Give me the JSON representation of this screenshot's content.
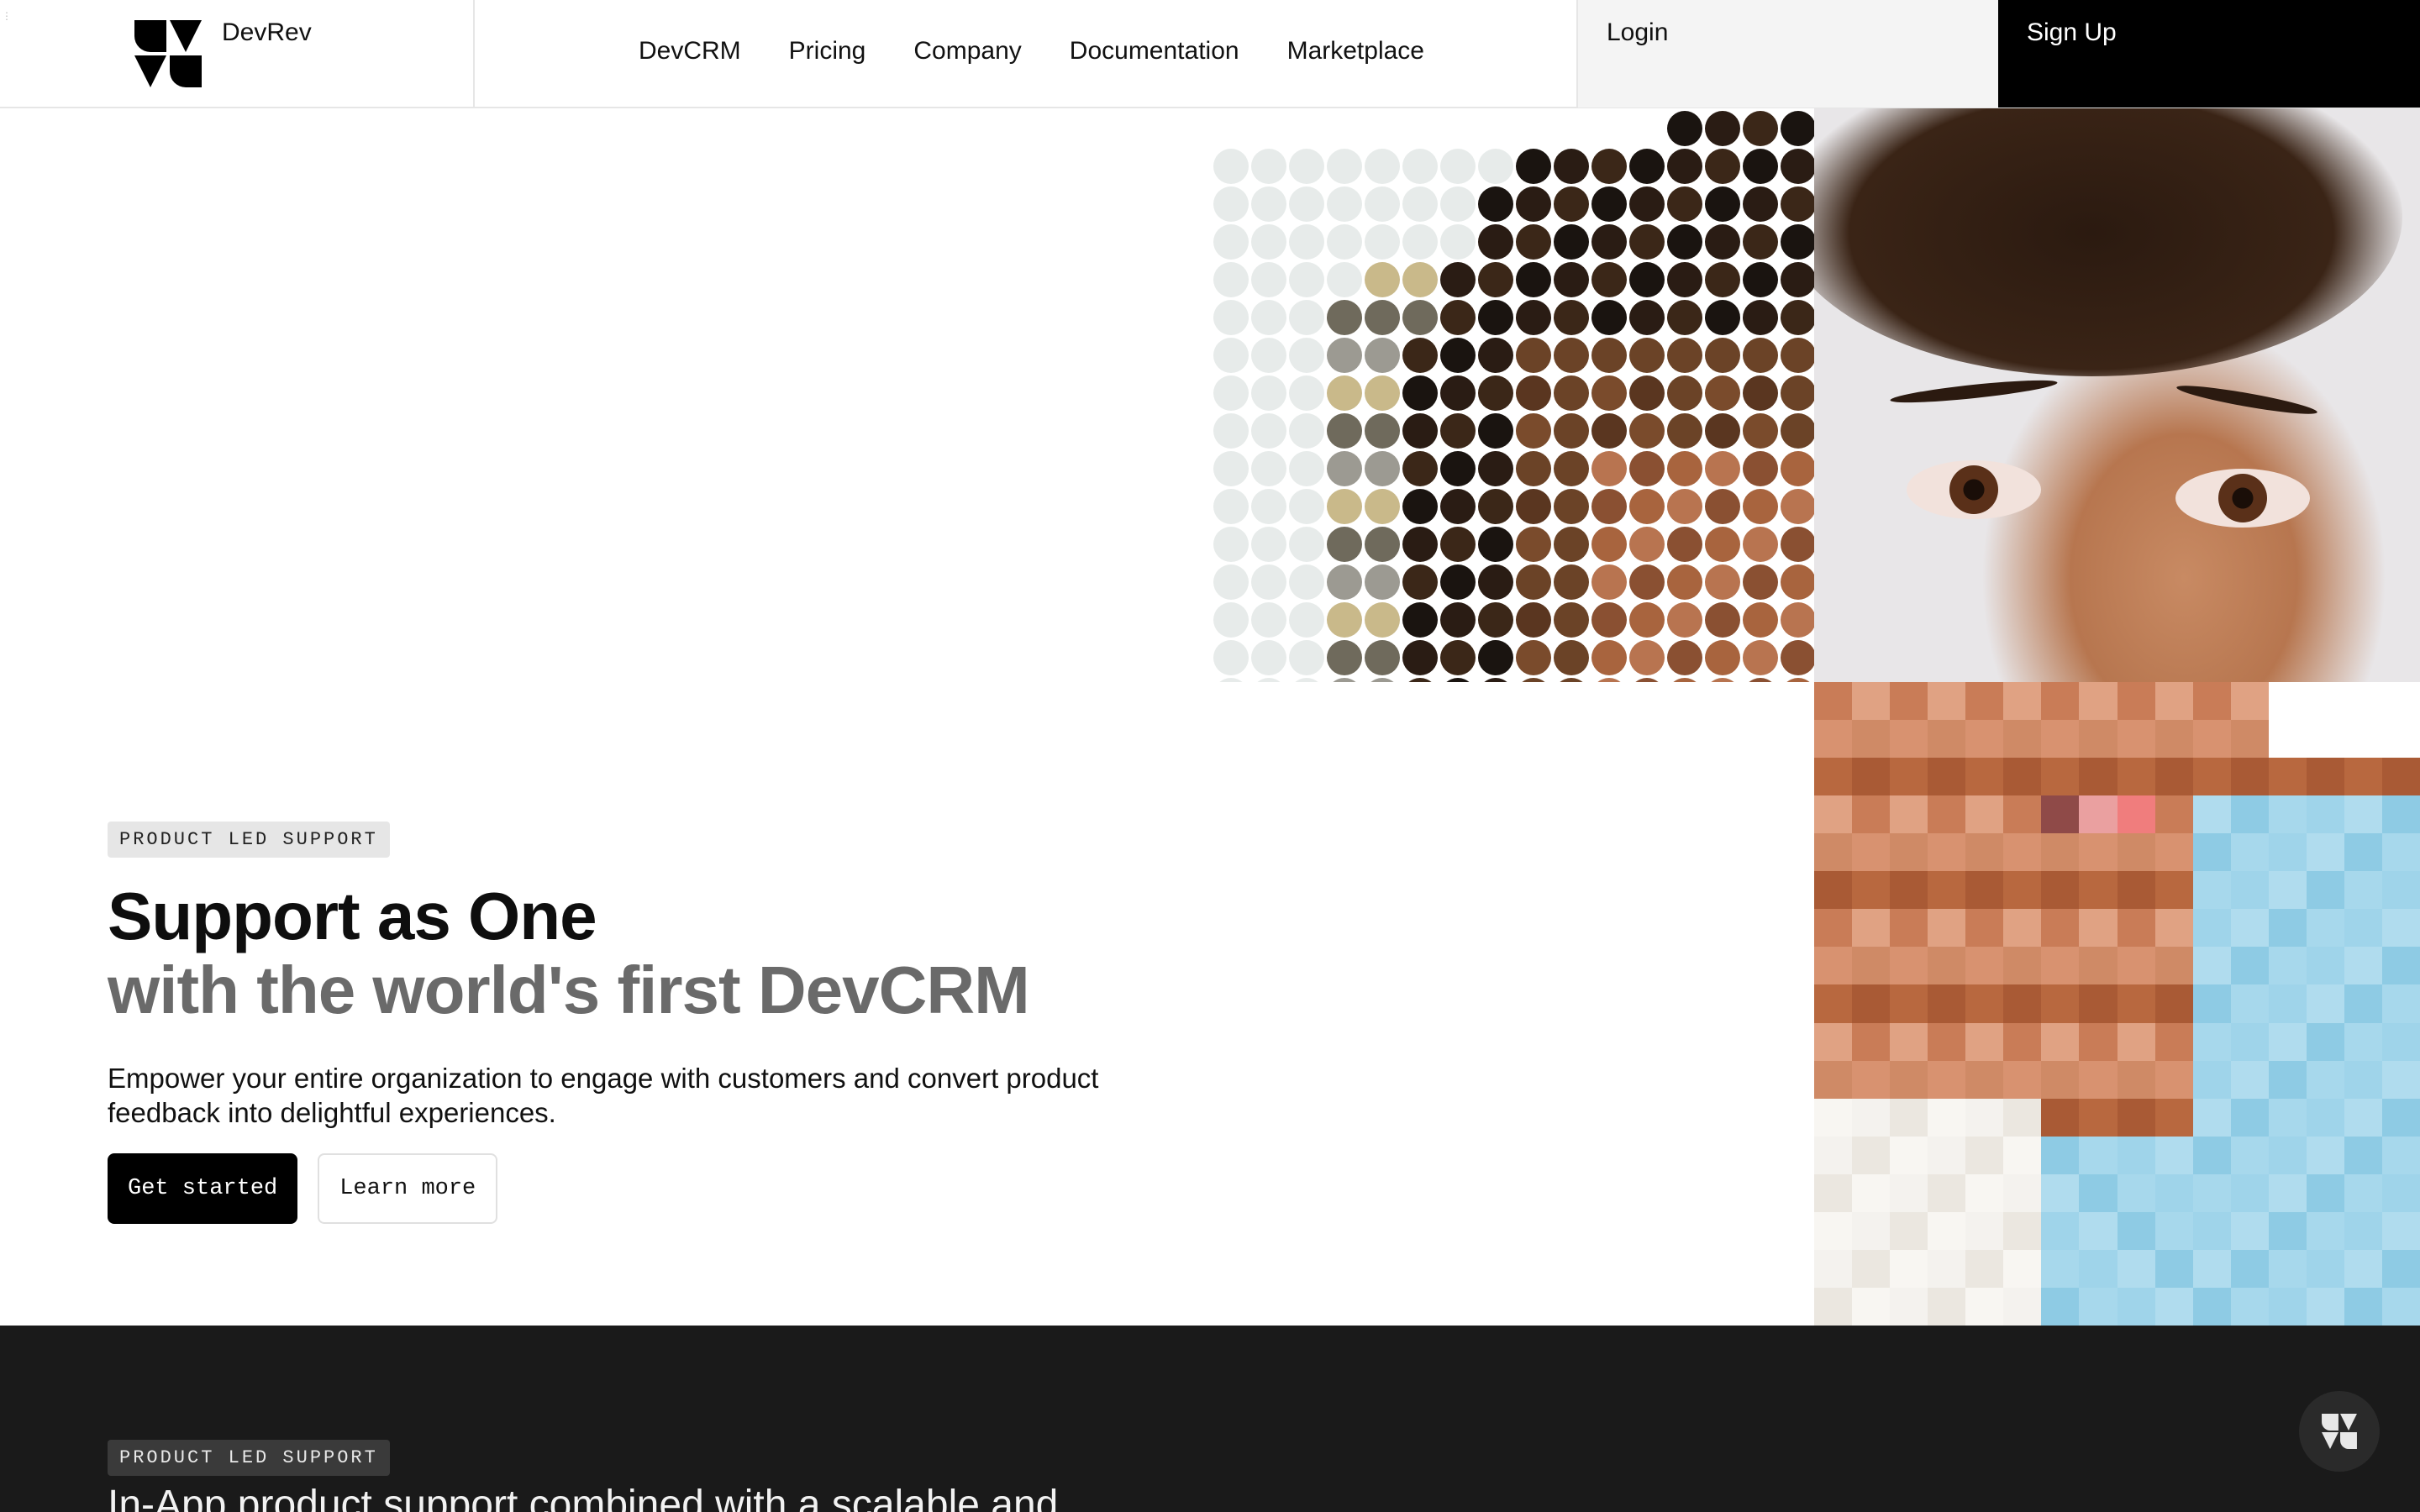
{
  "header": {
    "brand": "DevRev",
    "nav": [
      "DevCRM",
      "Pricing",
      "Company",
      "Documentation",
      "Marketplace"
    ],
    "login_label": "Login",
    "signup_label": "Sign Up"
  },
  "hero": {
    "tag": "PRODUCT LED SUPPORT",
    "headline_line1": "Support as One",
    "headline_line2": "with the world's first DevCRM",
    "lede": "Empower your entire organization to engage with customers and convert product feedback into delightful experiences.",
    "primary_cta": "Get started",
    "secondary_cta": "Learn more"
  },
  "section2": {
    "tag": "PRODUCT LED SUPPORT",
    "title": "In-App product support combined with a scalable and"
  },
  "icons": {
    "logo": "devrev-logo-icon",
    "fab": "devrev-chat-icon"
  },
  "colors": {
    "primary": "#000000",
    "dark_section": "#1a1a1a",
    "tag_bg": "#e6e6e6",
    "secondary_text": "#6a6a6a"
  }
}
